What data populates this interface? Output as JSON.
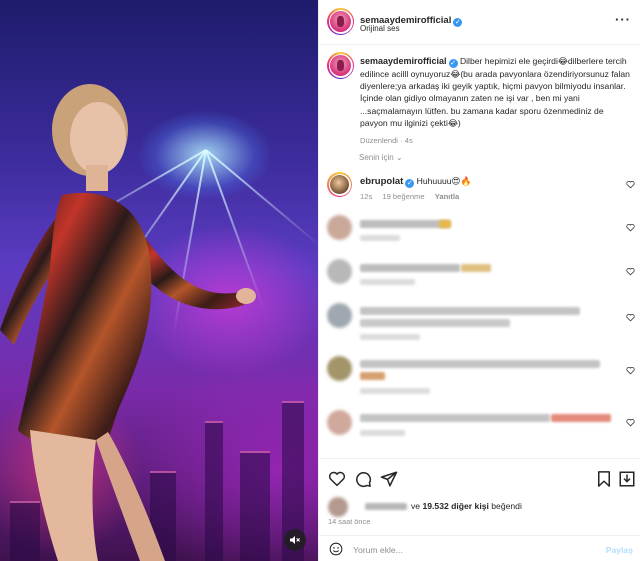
{
  "post": {
    "author": "semaaydemirofficial",
    "audio": "Orijinal ses",
    "caption": "Dilber hepimizi ele geçirdi😂dilberlere tercih edilince acilll oynuyoruz😂(bu arada pavyonlara özendiriyorsunuz falan diyenlere;ya arkadaş iki geyik yaptık, hiçmi pavyon bilmiyodu insanlar. İçinde olan gidiyo olmayanın zaten ne işi var , ben mi yani ...saçmalamayın lütfen. bu zamana kadar sporu özenmediniz de pavyon mu ilginizi çekti😂)",
    "edited": "Düzenlendi",
    "age": "4s"
  },
  "sort_label": "Senin için",
  "comments": [
    {
      "author": "ebrupolat",
      "text": "Huhuuuu😍🔥",
      "time": "12s",
      "likes": "19 beğenme",
      "reply": "Yanıtla"
    }
  ],
  "likes": {
    "prefix": "ve",
    "count_text": "19.532 diğer kişi",
    "suffix": "beğendi"
  },
  "time_ago": "14 saat önce",
  "comment_input": {
    "placeholder": "Yorum ekle...",
    "post_label": "Paylaş"
  },
  "icons": {
    "heart": "heart-icon",
    "comment": "comment-icon",
    "share": "share-icon",
    "save": "bookmark-icon",
    "more": "more-options-icon",
    "mute": "speaker-muted-icon",
    "emoji": "emoji-icon"
  },
  "colors": {
    "link_blue": "#3897f0",
    "text": "#262626",
    "muted": "#8e8e8e",
    "post_button": "#b2dffc"
  }
}
